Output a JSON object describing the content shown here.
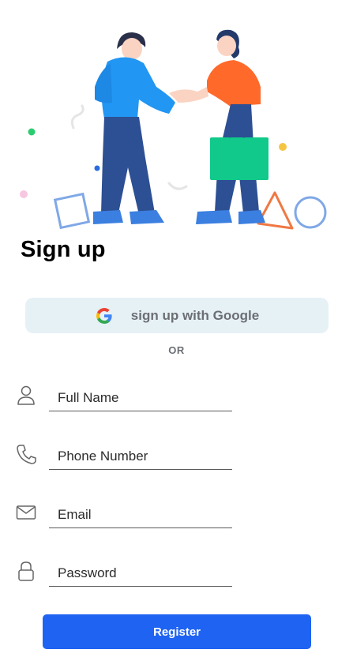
{
  "page": {
    "title": "Sign up"
  },
  "google_button": {
    "label": "sign up with Google",
    "icon": "google-g-icon"
  },
  "divider": {
    "label": "OR"
  },
  "fields": [
    {
      "placeholder": "Full Name",
      "value": "",
      "icon": "user-icon"
    },
    {
      "placeholder": "Phone Number",
      "value": "",
      "icon": "phone-icon"
    },
    {
      "placeholder": "Email",
      "value": "",
      "icon": "mail-icon"
    },
    {
      "placeholder": "Password",
      "value": "",
      "icon": "lock-icon"
    }
  ],
  "register_button": {
    "label": "Register"
  },
  "colors": {
    "accent": "#1f63f2",
    "google_button_bg": "#e6f1f6",
    "muted_text": "#6b6f74"
  }
}
